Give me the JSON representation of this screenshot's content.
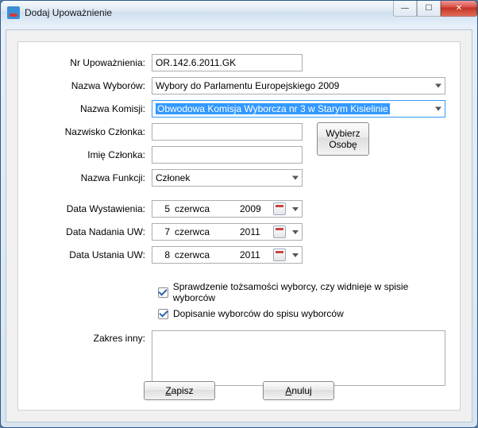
{
  "window": {
    "title": "Dodaj Upoważnienie"
  },
  "labels": {
    "nr": "Nr Upoważnienia:",
    "wybory": "Nazwa Wyborów:",
    "komisja": "Nazwa Komisji:",
    "nazwisko": "Nazwisko Członka:",
    "imie": "Imię Członka:",
    "funkcja": "Nazwa Funkcji:",
    "data_wyst": "Data Wystawienia:",
    "data_nad": "Data Nadania UW:",
    "data_ust": "Data Ustania UW:",
    "zakres": "Zakres inny:"
  },
  "fields": {
    "nr": "OR.142.6.2011.GK",
    "wybory": "Wybory do Parlamentu Europejskiego 2009",
    "komisja": "Obwodowa Komisja Wyborcza nr 3 w Starym Kisielinie",
    "nazwisko": "",
    "imie": "",
    "funkcja": "Członek",
    "zakres": ""
  },
  "dates": {
    "wyst": {
      "d": "5",
      "m": "czerwca",
      "y": "2009"
    },
    "nad": {
      "d": "7",
      "m": "czerwca",
      "y": "2011"
    },
    "ust": {
      "d": "8",
      "m": "czerwca",
      "y": "2011"
    }
  },
  "checkboxes": {
    "spr": {
      "checked": true,
      "label": "Sprawdzenie tożsamości wyborcy, czy widnieje w spisie wyborców"
    },
    "dop": {
      "checked": true,
      "label": "Dopisanie wyborców do spisu wyborców"
    }
  },
  "buttons": {
    "wybierz_l1": "Wybierz",
    "wybierz_l2": "Osobę",
    "zapisz_pre": "Z",
    "zapisz_post": "apisz",
    "anuluj_pre": "A",
    "anuluj_post": "nuluj"
  }
}
